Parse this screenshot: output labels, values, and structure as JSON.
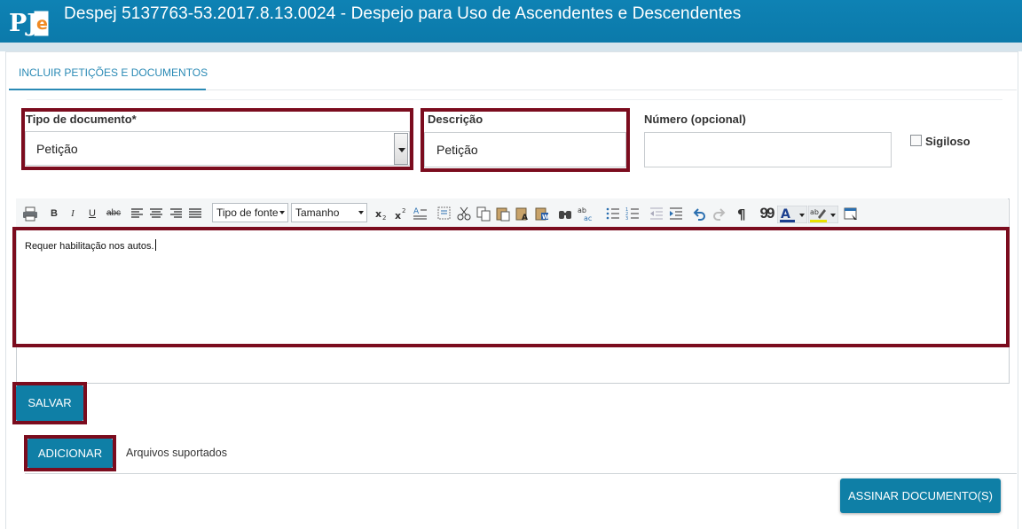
{
  "header": {
    "logo_text": "PJe",
    "title": "Despej 5137763-53.2017.8.13.0024 - Despejo para Uso de Ascendentes e Descendentes"
  },
  "tabs": [
    {
      "label": "INCLUIR PETIÇÕES E DOCUMENTOS",
      "active": true
    }
  ],
  "form": {
    "tipo_label": "Tipo de documento*",
    "tipo_value": "Petição",
    "descricao_label": "Descrição",
    "descricao_value": "Petição",
    "numero_label": "Número (opcional)",
    "numero_value": "",
    "sigiloso_label": "Sigiloso",
    "sigiloso_checked": false
  },
  "toolbar": {
    "bold": "B",
    "italic": "I",
    "underline": "U",
    "strike": "abc",
    "font_select": "Tipo de fonte",
    "size_select": "Tamanho",
    "quote": "99"
  },
  "editor": {
    "content": "Requer habilitação nos autos."
  },
  "actions": {
    "save_label": "SALVAR",
    "add_label": "ADICIONAR",
    "supported_label": "Arquivos suportados",
    "sign_label": "ASSINAR DOCUMENTO(S)"
  },
  "colors": {
    "header": "#0e82b4",
    "highlight": "#7b0c1e",
    "button": "#0f7fa6",
    "logo_orange": "#f08a24"
  }
}
